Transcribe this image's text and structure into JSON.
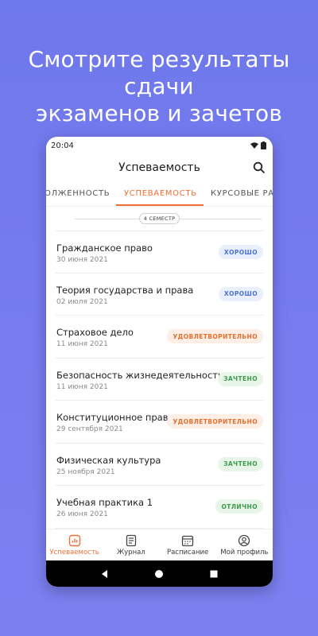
{
  "promo": {
    "line1": "Смотрите результаты сдачи",
    "line2": "экзаменов и зачетов"
  },
  "status_bar": {
    "time": "20:04"
  },
  "app_bar": {
    "title": "Успеваемость",
    "search_icon": "search-icon"
  },
  "tabs": [
    {
      "label": "ОЛЖЕННОСТЬ",
      "active": false
    },
    {
      "label": "УСПЕВАЕМОСТЬ",
      "active": true
    },
    {
      "label": "КУРСОВЫЕ РА",
      "active": false
    }
  ],
  "semester": {
    "label": "4 СЕМЕСТР"
  },
  "records": [
    {
      "subject": "Гражданское право",
      "date": "30 июня 2021",
      "grade": "ХОРОШО",
      "grade_type": "good"
    },
    {
      "subject": "Теория государства и права",
      "date": "02 июля 2021",
      "grade": "ХОРОШО",
      "grade_type": "good"
    },
    {
      "subject": "Страховое дело",
      "date": "11 июня 2021",
      "grade": "УДОВЛЕТВОРИТЕЛЬНО",
      "grade_type": "sat"
    },
    {
      "subject": "Безопасность жизнедеятельности",
      "date": "11 июня 2021",
      "grade": "ЗАЧТЕНО",
      "grade_type": "pass"
    },
    {
      "subject": "Конституционное право",
      "date": "29 сентября 2021",
      "grade": "УДОВЛЕТВОРИТЕЛЬНО",
      "grade_type": "sat"
    },
    {
      "subject": "Физическая культура",
      "date": "25 ноября 2021",
      "grade": "ЗАЧТЕНО",
      "grade_type": "pass"
    },
    {
      "subject": "Учебная практика 1",
      "date": "26 июня 2021",
      "grade": "ОТЛИЧНО",
      "grade_type": "pass"
    }
  ],
  "bottom_nav": [
    {
      "label": "Успеваемость",
      "icon": "chart-icon",
      "active": true
    },
    {
      "label": "Журнал",
      "icon": "journal-icon",
      "active": false
    },
    {
      "label": "Расписание",
      "icon": "calendar-icon",
      "active": false
    },
    {
      "label": "Мой профиль",
      "icon": "profile-icon",
      "active": false
    }
  ],
  "colors": {
    "accent": "#f07033",
    "background": "#7379ee",
    "badge_good": "#4b72d6",
    "badge_satisfactory": "#e3702f",
    "badge_pass": "#3e9a4d"
  }
}
